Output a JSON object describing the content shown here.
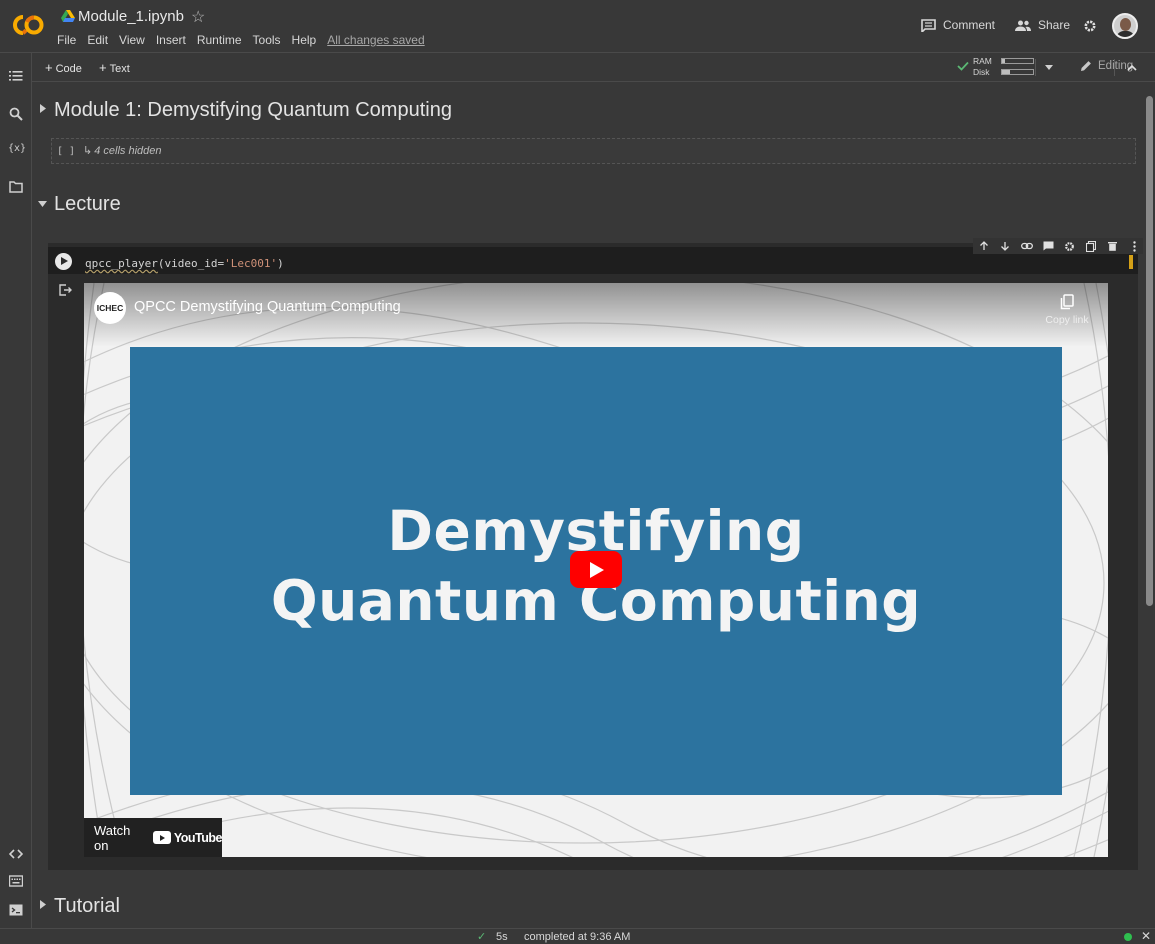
{
  "header": {
    "title": "Module_1.ipynb",
    "menu": [
      "File",
      "Edit",
      "View",
      "Insert",
      "Runtime",
      "Tools",
      "Help"
    ],
    "saved_status": "All changes saved",
    "comment_label": "Comment",
    "share_label": "Share"
  },
  "toolbar": {
    "add_code_label": "Code",
    "add_text_label": "Text",
    "ram_label": "RAM",
    "disk_label": "Disk",
    "ram_usage": 0.1,
    "disk_usage": 0.25,
    "editing_label": "Editing"
  },
  "notebook": {
    "section1_title": "Module 1: Demystifying Quantum Computing",
    "hidden_brackets": "[ ]",
    "hidden_cells_text": "4 cells hidden",
    "section2_title": "Lecture",
    "code_fn": "qpcc_player",
    "code_args_open": "(video_id=",
    "code_string": "'Lec001'",
    "code_close": ")",
    "video": {
      "channel_badge": "ICHEC",
      "title": "QPCC Demystifying Quantum Computing",
      "copy_link_label": "Copy link",
      "slide_line1": "Demystifying",
      "slide_line2": "Quantum Computing",
      "watch_on_label": "Watch on",
      "youtube_label": "YouTube"
    },
    "section3_title": "Tutorial"
  },
  "status_bar": {
    "duration": "5s",
    "completed_text": "completed at 9:36 AM"
  },
  "colors": {
    "accent_orange": "#f9ab00",
    "slide_blue": "#2c739f",
    "youtube_red": "#ff0000",
    "status_green": "#2fbf4f"
  }
}
